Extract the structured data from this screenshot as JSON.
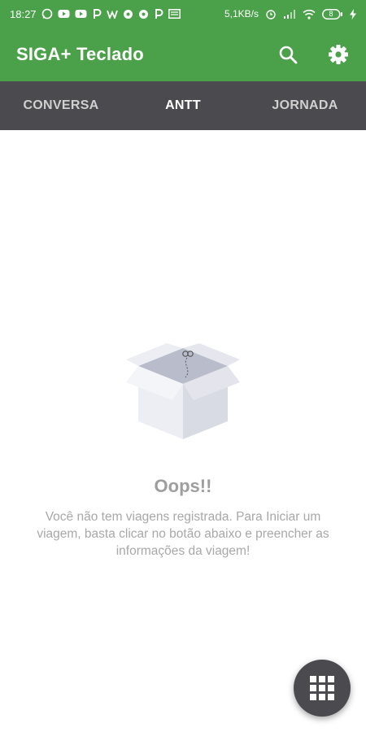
{
  "status_bar": {
    "time": "18:27",
    "network_speed": "5,1KB/s",
    "battery_level": "8",
    "notification_icons": [
      "whatsapp-icon",
      "youtube-icon",
      "youtube-icon",
      "p-icon",
      "w-icon",
      "game-icon",
      "game-icon",
      "p-icon",
      "news-icon"
    ]
  },
  "app_bar": {
    "title": "SIGA+ Teclado",
    "actions": [
      "search-icon",
      "settings-icon"
    ]
  },
  "tabs": [
    {
      "label": "CONVERSA",
      "active": false
    },
    {
      "label": "ANTT",
      "active": true
    },
    {
      "label": "JORNADA",
      "active": false
    }
  ],
  "empty_state": {
    "title": "Oops!!",
    "message": "Você não tem viagens registrada. Para Iniciar um viagem, basta clicar no botão abaixo e preencher as informações da viagem!"
  },
  "fab": {
    "icon": "grid-keypad-icon"
  },
  "colors": {
    "primary": "#4aa14a",
    "tab_bar": "#4a4a4f",
    "fab": "#4a4a4f",
    "muted_text": "#9e9e9e"
  }
}
